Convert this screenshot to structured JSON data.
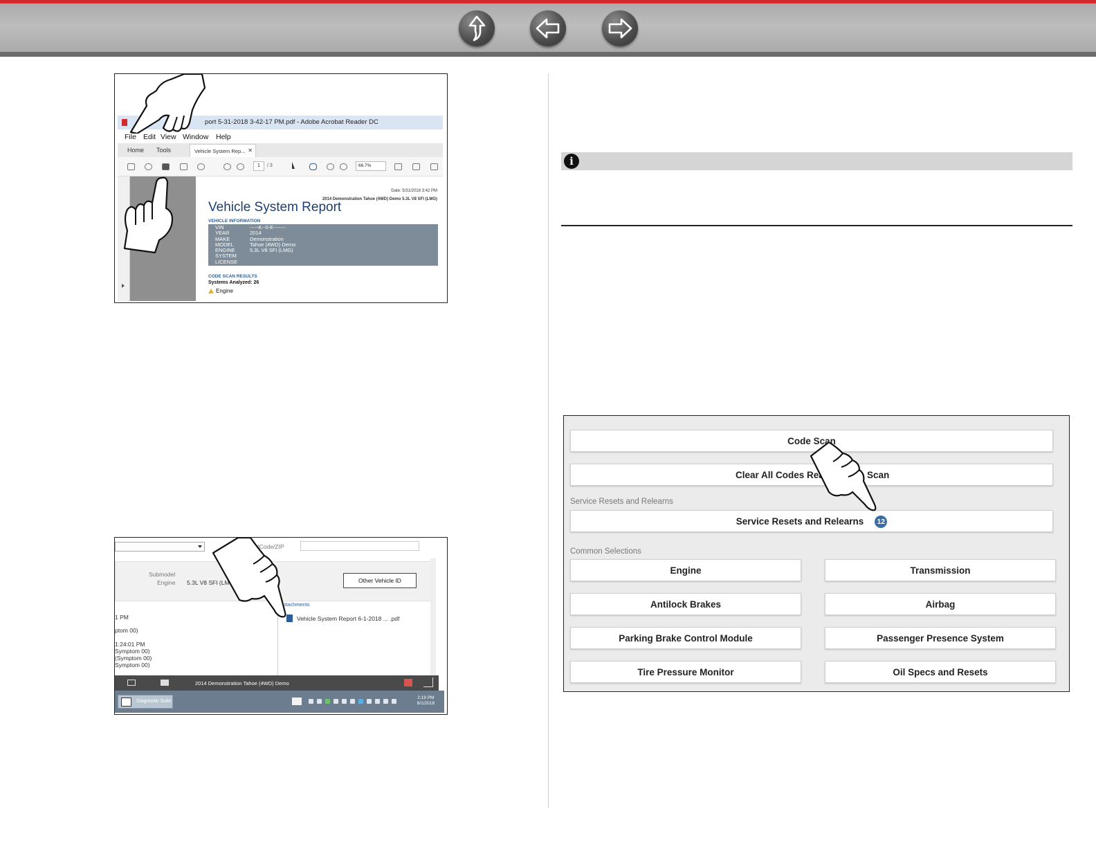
{
  "navigation": {
    "buttons": [
      {
        "name": "home-up-button",
        "icon": "up-arrow-icon"
      },
      {
        "name": "previous-page-button",
        "icon": "left-arrow-icon"
      },
      {
        "name": "next-page-button",
        "icon": "right-arrow-icon"
      }
    ]
  },
  "acrobat": {
    "window_title": "port 5-31-2018 3-42-17 PM.pdf - Adobe Acrobat Reader DC",
    "menu": [
      "File",
      "Edit",
      "View",
      "Window",
      "Help"
    ],
    "tabs": {
      "home": "Home",
      "tools": "Tools",
      "document": "Vehicle System Rep..."
    },
    "page_number": "1",
    "page_total": "/ 3",
    "zoom": "66.7%",
    "report": {
      "date": "Date: 5/31/2018 3:42 PM",
      "vehicle": "2014 Demonstration Tahoe (4WD) Demo 5.3L V8 SFI (LMG)",
      "title": "Vehicle System Report",
      "section_vehicle_info": "VEHICLE INFORMATION",
      "labels": "VIN\nYEAR\nMAKE\nMODEL\nENGINE\nSYSTEM\nLICENSE",
      "values": "-----K--0-E-------\n2014\nDemonstration\nTahoe (4WD) Demo\n5.3L V8 SFI (LMG)",
      "section_code_scan": "CODE SCAN RESULTS",
      "systems_analyzed": "Systems Analyzed: 26",
      "first_system": "Engine"
    }
  },
  "vehicle_screen": {
    "zip_label": "stCode/ZIP",
    "submodel_label": "Submodel",
    "engine_label": "Engine",
    "engine_value": "5.3L V8 SFI (LM",
    "other_vehicle_button": "Other Vehicle ID",
    "history": [
      "1 PM",
      "ptom 00)",
      "1:24:01 PM",
      "Symptom 00)",
      "(Symptom 00)",
      "Symptom 00)"
    ],
    "attachments_label": "Attachments",
    "attachment_file": "Vehicle System Report 6-1-2018 ... .pdf",
    "status_vehicle": "2014 Demonstration Tahoe (4WD) Demo",
    "taskbar_app": "Diagnostic Suite",
    "clock_time": "2:19 PM",
    "clock_date": "6/1/2018"
  },
  "service_menu": {
    "code_scan": "Code Scan",
    "clear_codes": "Clear All Codes Rea",
    "clear_codes_tail": "Scan",
    "service_section_label": "Service Resets and Relearns",
    "service_button": "Service Resets and Relearns",
    "service_badge": "12",
    "common_section_label": "Common Selections",
    "common": [
      "Engine",
      "Transmission",
      "Antilock Brakes",
      "Airbag",
      "Parking Brake Control Module",
      "Passenger Presence System",
      "Tire Pressure Monitor",
      "Oil Specs and Resets"
    ]
  },
  "note": {
    "icon": "info-icon"
  },
  "colors": {
    "accent_red": "#d12a2f",
    "badge_blue": "#3b6ea5",
    "report_blue": "#1d3f6e"
  }
}
